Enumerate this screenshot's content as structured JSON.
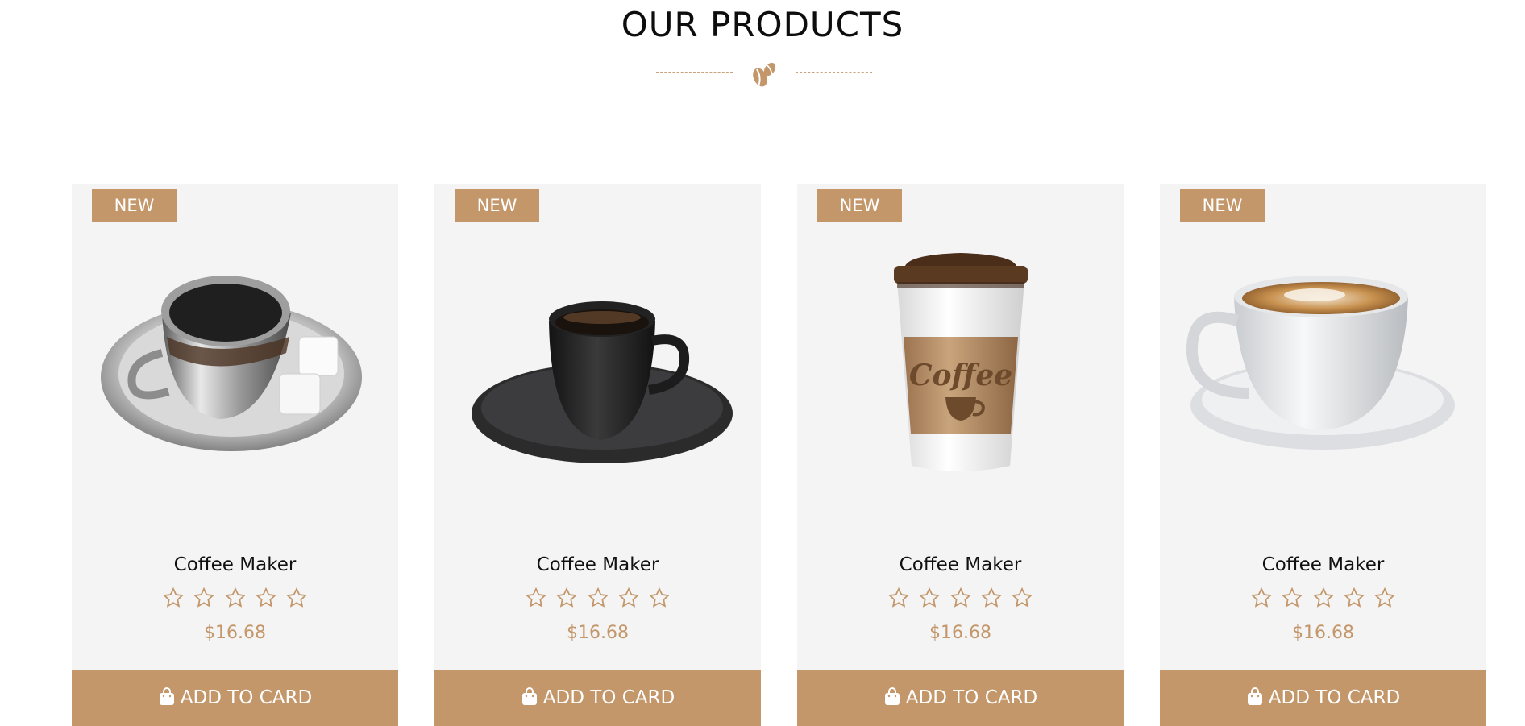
{
  "section": {
    "title": "OUR PRODUCTS",
    "divider_icon": "coffee-beans-icon"
  },
  "colors": {
    "accent": "#c3976a",
    "card_bg": "#f4f4f4",
    "title": "#0d0d0d"
  },
  "products": [
    {
      "badge": "NEW",
      "name": "Coffee Maker",
      "rating": 0,
      "rating_max": 5,
      "price": "$16.68",
      "button_label": "ADD TO CARD",
      "button_icon": "shopping-bag-icon",
      "image": "silver-coffee-cup-with-sugar-cubes"
    },
    {
      "badge": "NEW",
      "name": "Coffee Maker",
      "rating": 0,
      "rating_max": 5,
      "price": "$16.68",
      "button_label": "ADD TO CARD",
      "button_icon": "shopping-bag-icon",
      "image": "black-coffee-cup-on-saucer"
    },
    {
      "badge": "NEW",
      "name": "Coffee Maker",
      "rating": 0,
      "rating_max": 5,
      "price": "$16.68",
      "button_label": "ADD TO CARD",
      "button_icon": "shopping-bag-icon",
      "image": "takeaway-coffee-cup",
      "image_text": "Coffee"
    },
    {
      "badge": "NEW",
      "name": "Coffee Maker",
      "rating": 0,
      "rating_max": 5,
      "price": "$16.68",
      "button_label": "ADD TO CARD",
      "button_icon": "shopping-bag-icon",
      "image": "white-cappuccino-cup"
    }
  ]
}
